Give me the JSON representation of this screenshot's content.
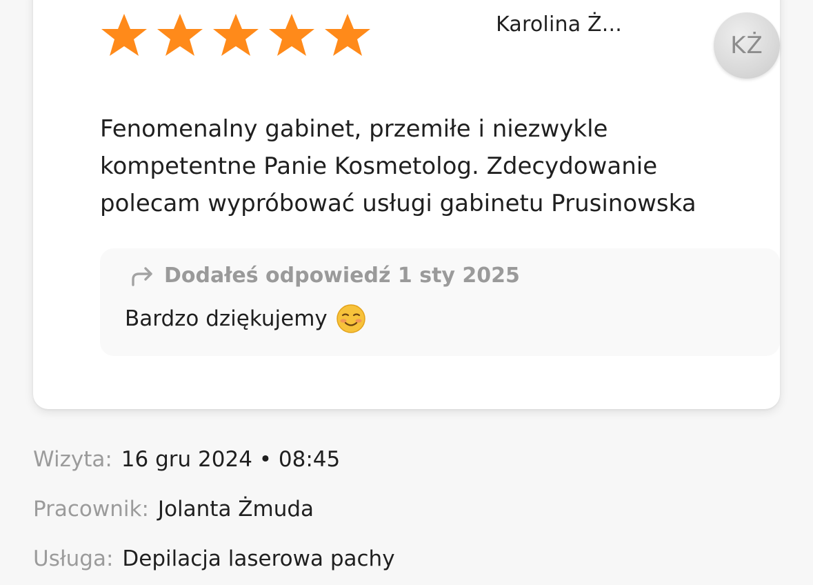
{
  "review": {
    "rating": 5,
    "rating_max": 5,
    "star_color": "#ff8a1a",
    "author_name": "Karolina Ż...",
    "author_initials": "KŻ",
    "text": "Fenomenalny gabinet, przemiłe i niezwykle kompetentne Panie Kosmetolog. Zdecydowanie polecam wypróbować usługi gabinetu Prusinowska"
  },
  "reply": {
    "icon": "reply-arrow-icon",
    "meta": "Dodałeś odpowiedź 1 sty 2025",
    "text": "Bardzo dziękujemy",
    "emoji": "smiling-face-icon"
  },
  "details": {
    "visit_label": "Wizyta:",
    "visit_value": "16 gru 2024 • 08:45",
    "employee_label": "Pracownik:",
    "employee_value": "Jolanta Żmuda",
    "service_label": "Usługa:",
    "service_value": "Depilacja laserowa pachy"
  }
}
